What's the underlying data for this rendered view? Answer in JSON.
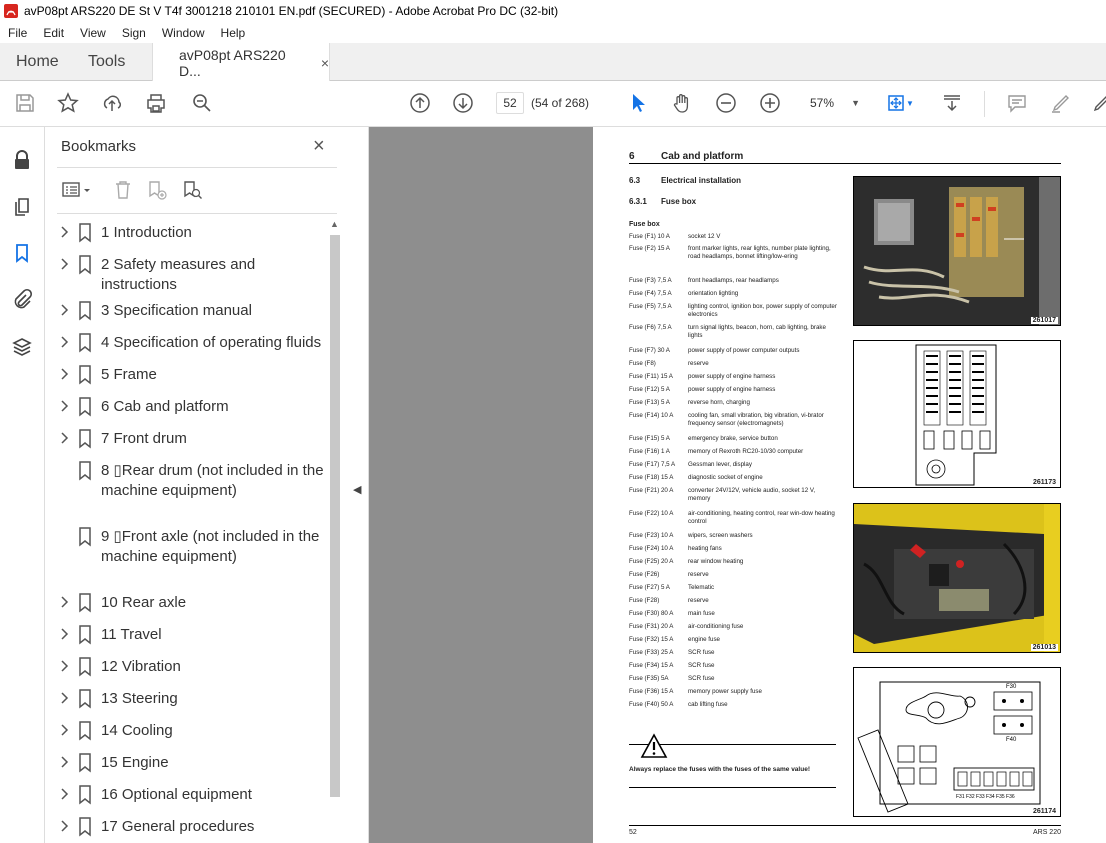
{
  "window": {
    "title": "avP08pt ARS220 DE St V T4f 3001218 210101 EN.pdf (SECURED) - Adobe Acrobat Pro DC (32-bit)"
  },
  "menu": [
    "File",
    "Edit",
    "View",
    "Sign",
    "Window",
    "Help"
  ],
  "tabs": {
    "home": "Home",
    "tools": "Tools",
    "document": "avP08pt ARS220 D...",
    "document_close": "×"
  },
  "toolbar": {
    "page_number": "52",
    "page_count": "(54 of 268)",
    "zoom": "57%"
  },
  "bookmarks": {
    "header": "Bookmarks",
    "close": "×",
    "items": [
      {
        "label": "1 Introduction",
        "expandable": true
      },
      {
        "label": "2 Safety measures and instructions",
        "expandable": true
      },
      {
        "label": "3 Specification manual",
        "expandable": true
      },
      {
        "label": "4 Specification of operating fluids",
        "expandable": true
      },
      {
        "label": "5 Frame",
        "expandable": true
      },
      {
        "label": "6 Cab and platform",
        "expandable": true
      },
      {
        "label": "7 Front drum",
        "expandable": true
      },
      {
        "label": "8 ▯Rear drum (not included in the machine equipment)",
        "expandable": false
      },
      {
        "label": "9 ▯Front axle (not included in the machine equipment)",
        "expandable": false
      },
      {
        "label": "10 Rear axle",
        "expandable": true
      },
      {
        "label": "11 Travel",
        "expandable": true
      },
      {
        "label": "12 Vibration",
        "expandable": true
      },
      {
        "label": "13 Steering",
        "expandable": true
      },
      {
        "label": "14 Cooling",
        "expandable": true
      },
      {
        "label": "15 Engine",
        "expandable": true
      },
      {
        "label": "16 Optional equipment",
        "expandable": true
      },
      {
        "label": "17 General procedures",
        "expandable": true
      }
    ]
  },
  "document_page": {
    "chapter_num": "6",
    "chapter_title": "Cab and platform",
    "section_num": "6.3",
    "section_title": "Electrical installation",
    "subsection_num": "6.3.1",
    "subsection_title": "Fuse box",
    "fuse_box_label": "Fuse box",
    "fuses": [
      {
        "k": "Fuse (F1) 10 A",
        "v": "socket 12 V"
      },
      {
        "k": "Fuse (F2) 15 A",
        "v": "front marker lights, rear lights, number plate lighting, road headlamps, bonnet lifting/low-ering"
      },
      {
        "k": "Fuse (F3) 7,5 A",
        "v": "front headlamps, rear headlamps"
      },
      {
        "k": "Fuse (F4) 7,5 A",
        "v": "orientation lighting"
      },
      {
        "k": "Fuse (F5) 7,5 A",
        "v": "lighting control, ignition box, power supply of computer electronics"
      },
      {
        "k": "Fuse (F6) 7,5 A",
        "v": "turn signal lights, beacon, horn, cab lighting, brake lights"
      },
      {
        "k": "Fuse (F7) 30 A",
        "v": "power supply of power computer outputs"
      },
      {
        "k": "Fuse (F8)",
        "v": "reserve"
      },
      {
        "k": "Fuse (F11) 15 A",
        "v": "power supply of engine harness"
      },
      {
        "k": "Fuse (F12) 5 A",
        "v": "power supply of engine harness"
      },
      {
        "k": "Fuse (F13) 5 A",
        "v": "reverse horn, charging"
      },
      {
        "k": "Fuse (F14) 10 A",
        "v": "cooling fan, small vibration, big vibration, vi-brator frequency sensor (electromagnets)"
      },
      {
        "k": "Fuse (F15) 5 A",
        "v": "emergency brake, service button"
      },
      {
        "k": "Fuse (F16) 1 A",
        "v": "memory of Rexroth RC20-10/30 computer"
      },
      {
        "k": "Fuse (F17) 7,5 A",
        "v": "Gessman lever, display"
      },
      {
        "k": "Fuse (F18) 15 A",
        "v": "diagnostic socket of engine"
      },
      {
        "k": "Fuse (F21) 20 A",
        "v": "converter 24V/12V, vehicle audio, socket 12 V, memory"
      },
      {
        "k": "Fuse (F22) 10 A",
        "v": "air-conditioning, heating control, rear win-dow heating control"
      },
      {
        "k": "Fuse (F23) 10 A",
        "v": "wipers, screen washers"
      },
      {
        "k": "Fuse (F24) 10 A",
        "v": "heating fans"
      },
      {
        "k": "Fuse (F25) 20 A",
        "v": "rear window heating"
      },
      {
        "k": "Fuse (F26)",
        "v": "reserve"
      },
      {
        "k": "Fuse (F27) 5 A",
        "v": "Telematic"
      },
      {
        "k": "Fuse (F28)",
        "v": "reserve"
      },
      {
        "k": "Fuse (F30) 80 A",
        "v": "main fuse"
      },
      {
        "k": "Fuse (F31) 20 A",
        "v": "air-conditioning fuse"
      },
      {
        "k": "Fuse (F32) 15 A",
        "v": "engine fuse"
      },
      {
        "k": "Fuse (F33) 25 A",
        "v": "SCR fuse"
      },
      {
        "k": "Fuse (F34) 15 A",
        "v": "SCR fuse"
      },
      {
        "k": "Fuse (F35) 5A",
        "v": "SCR fuse"
      },
      {
        "k": "Fuse (F36) 15 A",
        "v": "memory power supply fuse"
      },
      {
        "k": "Fuse (F40) 50 A",
        "v": "cab lifting fuse"
      }
    ],
    "warning": "Always replace the fuses with the fuses of the same value!",
    "figures": [
      "261017",
      "261173",
      "261013",
      "261174"
    ],
    "diagram_labels": {
      "f30": "F30",
      "f40": "F40",
      "row": "F31 F32 F33 F34 F35 F36"
    },
    "footer_page": "52",
    "footer_model": "ARS 220"
  }
}
